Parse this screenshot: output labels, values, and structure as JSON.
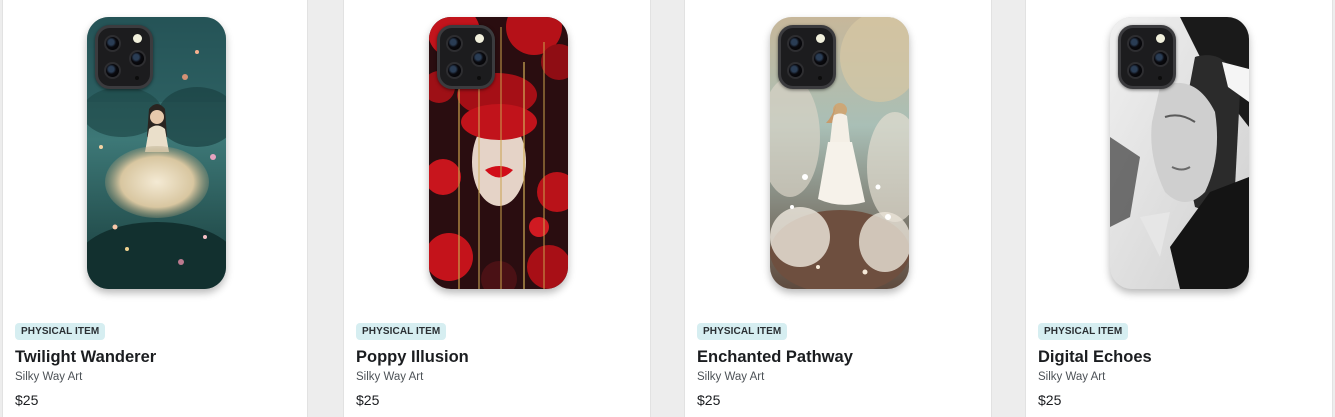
{
  "products": [
    {
      "badge": "PHYSICAL ITEM",
      "title": "Twilight Wanderer",
      "seller": "Silky Way Art",
      "price": "$25",
      "image_icon": "phone-case-artwork"
    },
    {
      "badge": "PHYSICAL ITEM",
      "title": "Poppy Illusion",
      "seller": "Silky Way Art",
      "price": "$25",
      "image_icon": "phone-case-artwork"
    },
    {
      "badge": "PHYSICAL ITEM",
      "title": "Enchanted Pathway",
      "seller": "Silky Way Art",
      "price": "$25",
      "image_icon": "phone-case-artwork"
    },
    {
      "badge": "PHYSICAL ITEM",
      "title": "Digital Echoes",
      "seller": "Silky Way Art",
      "price": "$25",
      "image_icon": "phone-case-artwork"
    }
  ],
  "colors": {
    "badge_background": "#d6eef1",
    "page_background": "#ededed",
    "card_background": "#ffffff"
  }
}
